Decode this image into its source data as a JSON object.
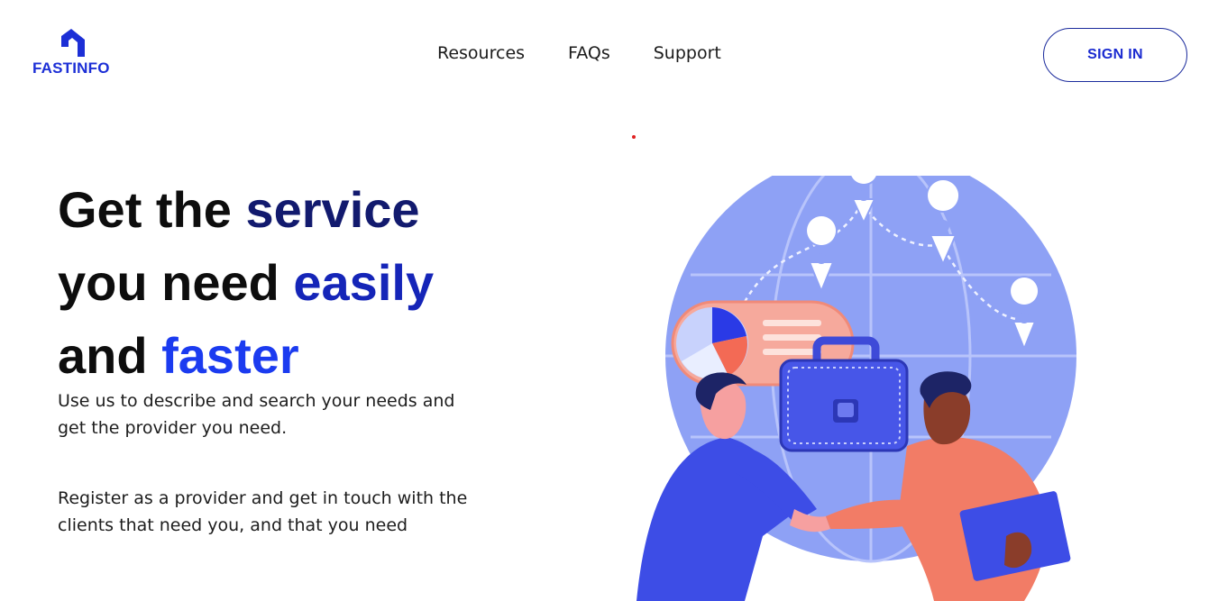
{
  "header": {
    "logo_text": "FASTINFO",
    "nav": [
      "Resources",
      "FAQs",
      "Support"
    ],
    "signin_label": "SIGN IN"
  },
  "hero": {
    "title": {
      "line1_plain": "Get the ",
      "line1_accent": "service",
      "line2_plain": "you need ",
      "line2_accent": "easily",
      "line3_plain": "and ",
      "line3_accent": "faster"
    },
    "description_1": "Use us to describe and search your needs and get the provider you need.",
    "description_2": "Register as a provider and get in touch with the clients that need you, and that you need"
  },
  "colors": {
    "brand_blue": "#1c2fd6",
    "accent_navy": "#121a6e",
    "accent_indigo": "#1525b8",
    "accent_blue": "#1b3bf0"
  },
  "icons": {
    "logo": "house-logo-icon",
    "illustration": "handshake-globe-illustration"
  }
}
